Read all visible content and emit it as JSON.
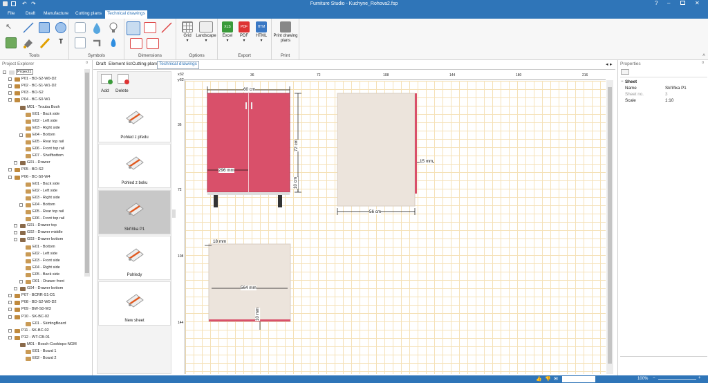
{
  "window": {
    "title": "Furniture Studio - Kuchyne_Rohova2.fsp"
  },
  "menu_tabs": [
    {
      "label": "File"
    },
    {
      "label": "Draft"
    },
    {
      "label": "Manufacture"
    },
    {
      "label": "Cutting plans"
    },
    {
      "label": "Technical drawings"
    }
  ],
  "ribbon": {
    "groups": {
      "tools": "Tools",
      "symbols": "Symbols",
      "dimensions": "Dimensions",
      "options": "Options",
      "export": "Export",
      "print": "Print"
    },
    "grid": "Grid",
    "landscape": "Landscape",
    "excel": "Excel",
    "pdf": "PDF",
    "html": "HTML",
    "print_plans_1": "Print drawing",
    "print_plans_2": "plans",
    "excel_badge": "XLS",
    "pdf_badge": "PDF",
    "html_badge": "HTM"
  },
  "explorer": {
    "title": "Project Explorer",
    "items": [
      "Project1",
      "P01 - BD-S2-W0-D2",
      "P02 - BC-S1-W1-D2",
      "P03 - BO-S2",
      "P04 - BC-S0-W1",
      "M01 - Trouba Bosh",
      "E01 - Back side",
      "E02 - Left side",
      "E03 - Right side",
      "E04 - Bottom",
      "E05 - Rear top rail",
      "E06 - Front top rail",
      "E07 - Shelfbottom",
      "G01 - Drawer",
      "P05 - BO-S2",
      "P06 - BC-S0-W4",
      "E01 - Back side",
      "E02 - Left side",
      "E03 - Right side",
      "E04 - Bottom",
      "E05 - Rear top rail",
      "E06 - Front top rail",
      "G01 - Drawer top",
      "G02 - Drawer middle",
      "G03 - Drawer bottom",
      "E01 - Bottom",
      "E02 - Left side",
      "E03 - Front side",
      "E04 - Right side",
      "E05 - Back side",
      "D01 - Drawer front",
      "G04 - Drawer bottom",
      "P07 - BCRR-S1-D1",
      "P08 - BD-S2-W0-D2",
      "P09 - BW-S0-W3",
      "P10 - SK-BC-02",
      "E01 - SkirtingBoard",
      "P11 - SK-BC-02",
      "P12 - WT-CB-01",
      "M01 - Bosch-Cooktops-NGM",
      "E01 - Board 1",
      "E02 - Board 2"
    ]
  },
  "doc_tabs": [
    {
      "label": "Draft"
    },
    {
      "label": "Element list"
    },
    {
      "label": "Cutting plans"
    },
    {
      "label": "Technical drawings"
    }
  ],
  "sheet_panel": {
    "add": "Add",
    "delete": "Delete",
    "sheets": [
      {
        "label": "Pohled z předu"
      },
      {
        "label": "Pohled z boku"
      },
      {
        "label": "Skříňka P1"
      },
      {
        "label": "Pohledy"
      },
      {
        "label": "New sheet"
      }
    ]
  },
  "ruler": {
    "corner_top": "x32",
    "corner_bottom": "y62",
    "top_ticks": [
      "36",
      "72",
      "108",
      "144",
      "180",
      "216"
    ],
    "left_ticks": [
      "36",
      "72",
      "108",
      "144"
    ]
  },
  "dimensions": {
    "front_width": "60 cm",
    "front_height": "72 cm",
    "door_width": "296 mm",
    "leg_height": "10 cm",
    "side_depth": "56 cm",
    "side_thickness": "15 mm",
    "bottom_edge": "18 mm",
    "bottom_width": "564 mm",
    "bottom_thickness": "10 mm"
  },
  "properties": {
    "title": "Properties",
    "section": "Sheet",
    "rows": [
      {
        "key": "Name",
        "value": "Skříňka P1"
      },
      {
        "key": "Sheet no.",
        "value": "3"
      },
      {
        "key": "Scale",
        "value": "1:10"
      }
    ]
  },
  "status": {
    "zoom": "100%"
  },
  "colors": {
    "accent": "#2f75b8",
    "cabinet": "#d9506a",
    "wood": "#ece4dc"
  }
}
